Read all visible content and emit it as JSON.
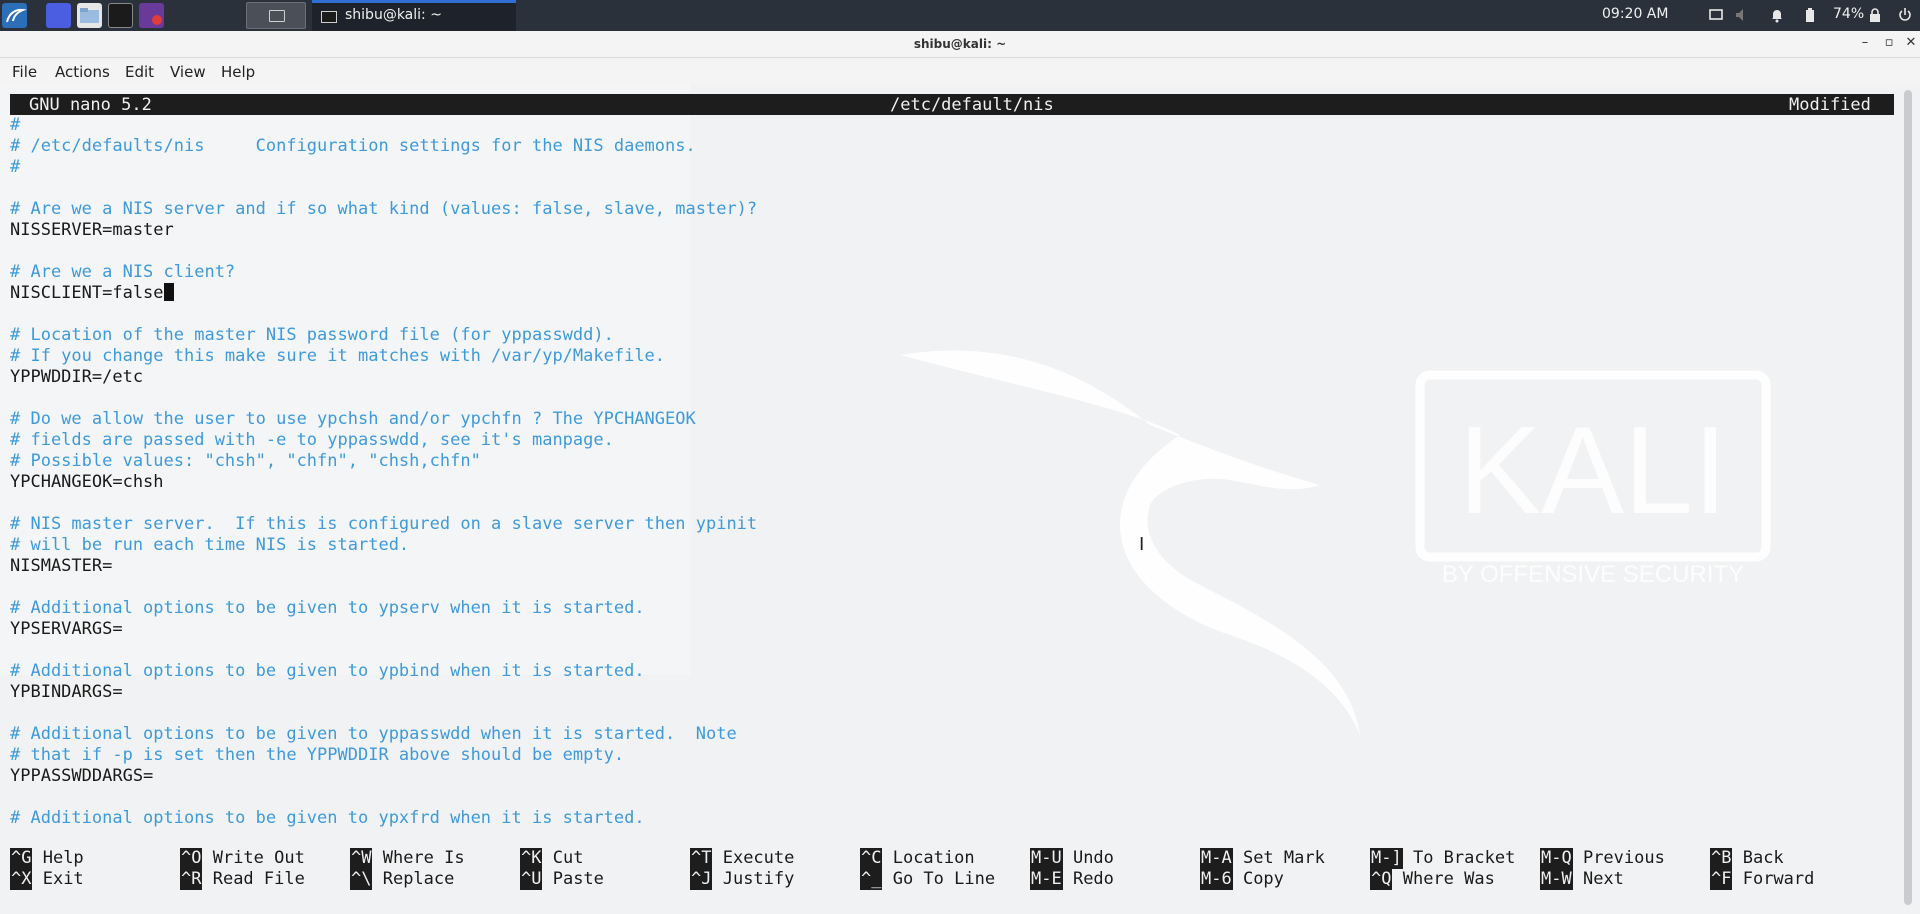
{
  "panel": {
    "task_label": "shibu@kali: ~",
    "clock": "09:20 AM",
    "battery": "74%",
    "icons": [
      "kali-menu-icon",
      "desktop-icon",
      "file-manager-icon",
      "terminal-icon",
      "recorder-icon"
    ],
    "tray_icons": [
      "display-icon",
      "volume-icon",
      "bell-icon",
      "battery-icon",
      "lock-icon",
      "power-icon"
    ]
  },
  "window": {
    "title": "shibu@kali: ~",
    "menu": [
      "File",
      "Actions",
      "Edit",
      "View",
      "Help"
    ]
  },
  "nano": {
    "version": "GNU nano 5.2",
    "filename": "/etc/default/nis",
    "status": "Modified",
    "lines": [
      {
        "type": "comment",
        "text": "#"
      },
      {
        "type": "comment",
        "text": "# /etc/defaults/nis     Configuration settings for the NIS daemons."
      },
      {
        "type": "comment",
        "text": "#"
      },
      {
        "type": "blank",
        "text": ""
      },
      {
        "type": "comment",
        "text": "# Are we a NIS server and if so what kind (values: false, slave, master)?"
      },
      {
        "type": "code",
        "text": "NISSERVER=master"
      },
      {
        "type": "blank",
        "text": ""
      },
      {
        "type": "comment",
        "text": "# Are we a NIS client?"
      },
      {
        "type": "code-cursor",
        "text": "NISCLIENT=false"
      },
      {
        "type": "blank",
        "text": ""
      },
      {
        "type": "comment",
        "text": "# Location of the master NIS password file (for yppasswdd)."
      },
      {
        "type": "comment",
        "text": "# If you change this make sure it matches with /var/yp/Makefile."
      },
      {
        "type": "code",
        "text": "YPPWDDIR=/etc"
      },
      {
        "type": "blank",
        "text": ""
      },
      {
        "type": "comment",
        "text": "# Do we allow the user to use ypchsh and/or ypchfn ? The YPCHANGEOK"
      },
      {
        "type": "comment",
        "text": "# fields are passed with -e to yppasswdd, see it's manpage."
      },
      {
        "type": "comment",
        "text": "# Possible values: \"chsh\", \"chfn\", \"chsh,chfn\""
      },
      {
        "type": "code",
        "text": "YPCHANGEOK=chsh"
      },
      {
        "type": "blank",
        "text": ""
      },
      {
        "type": "comment",
        "text": "# NIS master server.  If this is configured on a slave server then ypinit"
      },
      {
        "type": "comment",
        "text": "# will be run each time NIS is started."
      },
      {
        "type": "code",
        "text": "NISMASTER="
      },
      {
        "type": "blank",
        "text": ""
      },
      {
        "type": "comment",
        "text": "# Additional options to be given to ypserv when it is started."
      },
      {
        "type": "code",
        "text": "YPSERVARGS="
      },
      {
        "type": "blank",
        "text": ""
      },
      {
        "type": "comment",
        "text": "# Additional options to be given to ypbind when it is started."
      },
      {
        "type": "code",
        "text": "YPBINDARGS="
      },
      {
        "type": "blank",
        "text": ""
      },
      {
        "type": "comment",
        "text": "# Additional options to be given to yppasswdd when it is started.  Note"
      },
      {
        "type": "comment",
        "text": "# that if -p is set then the YPPWDDIR above should be empty."
      },
      {
        "type": "code",
        "text": "YPPASSWDDARGS="
      },
      {
        "type": "blank",
        "text": ""
      },
      {
        "type": "comment",
        "text": "# Additional options to be given to ypxfrd when it is started."
      }
    ],
    "shortcuts": [
      [
        {
          "key": "^G",
          "label": " Help"
        },
        {
          "key": "^X",
          "label": " Exit"
        }
      ],
      [
        {
          "key": "^O",
          "label": " Write Out"
        },
        {
          "key": "^R",
          "label": " Read File"
        }
      ],
      [
        {
          "key": "^W",
          "label": " Where Is"
        },
        {
          "key": "^\\",
          "label": " Replace"
        }
      ],
      [
        {
          "key": "^K",
          "label": " Cut"
        },
        {
          "key": "^U",
          "label": " Paste"
        }
      ],
      [
        {
          "key": "^T",
          "label": " Execute"
        },
        {
          "key": "^J",
          "label": " Justify"
        }
      ],
      [
        {
          "key": "^C",
          "label": " Location"
        },
        {
          "key": "^_",
          "label": " Go To Line"
        }
      ],
      [
        {
          "key": "M-U",
          "label": " Undo"
        },
        {
          "key": "M-E",
          "label": " Redo"
        }
      ],
      [
        {
          "key": "M-A",
          "label": " Set Mark"
        },
        {
          "key": "M-6",
          "label": " Copy"
        }
      ],
      [
        {
          "key": "M-]",
          "label": " To Bracket"
        },
        {
          "key": "^Q",
          "label": " Where Was"
        }
      ],
      [
        {
          "key": "M-Q",
          "label": " Previous"
        },
        {
          "key": "M-W",
          "label": " Next"
        }
      ],
      [
        {
          "key": "^B",
          "label": " Back"
        },
        {
          "key": "^F",
          "label": " Forward"
        }
      ]
    ]
  },
  "wallpaper": {
    "logo_text": "KALI",
    "tagline": "BY OFFENSIVE SECURITY"
  }
}
